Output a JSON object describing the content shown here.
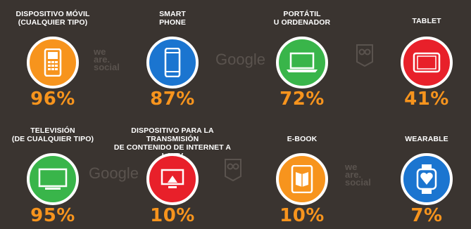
{
  "colors": {
    "background": "#3a3430",
    "accent": "#f7941d",
    "orange": "#f7941d",
    "blue": "#1b75d0",
    "green": "#39b54a",
    "red": "#e8202a"
  },
  "devices": [
    {
      "label": "DISPOSITIVO MÓVIL\n(CUALQUIER TIPO)",
      "percent": "96%",
      "icon": "mobile-phone-icon",
      "color": "#f7941d"
    },
    {
      "label": "SMART\nPHONE",
      "percent": "87%",
      "icon": "smartphone-icon",
      "color": "#1b75d0"
    },
    {
      "label": "PORTÁTIL\nU ORDENADOR",
      "percent": "72%",
      "icon": "laptop-icon",
      "color": "#39b54a"
    },
    {
      "label": "TABLET",
      "percent": "41%",
      "icon": "tablet-icon",
      "color": "#e8202a"
    },
    {
      "label": "TELEVISIÓN\n(DE CUALQUIER TIPO)",
      "percent": "95%",
      "icon": "television-icon",
      "color": "#39b54a"
    },
    {
      "label": "DISPOSITIVO PARA LA TRANSMISIÓN\nDE CONTENIDO DE INTERNET A LA TV",
      "percent": "10%",
      "icon": "streaming-device-icon",
      "color": "#e8202a"
    },
    {
      "label": "E-BOOK",
      "percent": "10%",
      "icon": "ebook-icon",
      "color": "#f7941d"
    },
    {
      "label": "WEARABLE",
      "percent": "7%",
      "icon": "smartwatch-icon",
      "color": "#1b75d0"
    }
  ],
  "watermarks": {
    "google": "Google",
    "wearesocial": "we\nare.\nsocial"
  }
}
